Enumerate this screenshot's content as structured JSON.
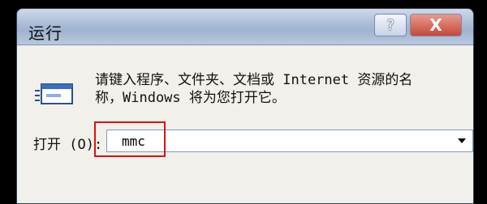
{
  "window": {
    "title": "运行",
    "help_glyph": "?",
    "close_glyph": "X"
  },
  "dialog": {
    "description_line1": "请键入程序、文件夹、文档或 Internet 资源的名",
    "description_line2": "称，Windows 将为您打开它。",
    "open_label": "打开 (O):",
    "input_value": "mmc"
  },
  "colors": {
    "highlight_border": "#dd1111",
    "background": "#000000"
  },
  "icons": {
    "run": "run-icon",
    "dropdown": "chevron-down-icon",
    "help": "help-icon",
    "close": "close-icon"
  }
}
